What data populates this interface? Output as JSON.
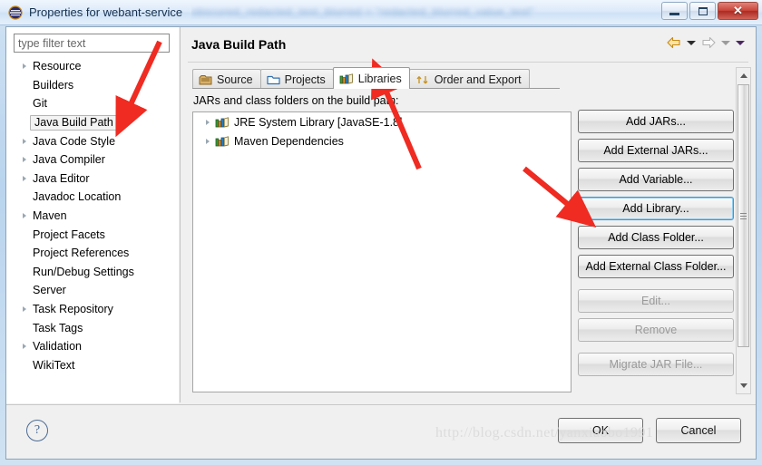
{
  "window": {
    "title": "Properties for webant-service",
    "title_blurred_suffix": "obscured_redacted_text_blurred = \"redacted_blurred_value_text\"",
    "icon": "eclipse-icon",
    "controls": {
      "minimize": "minimize-icon",
      "maximize": "maximize-icon",
      "close": "✕"
    }
  },
  "sidebar": {
    "filter": {
      "placeholder": "type filter text",
      "value": ""
    },
    "items": [
      {
        "label": "Resource",
        "expandable": true,
        "selected": false
      },
      {
        "label": "Builders",
        "expandable": false,
        "selected": false
      },
      {
        "label": "Git",
        "expandable": false,
        "selected": false
      },
      {
        "label": "Java Build Path",
        "expandable": false,
        "selected": true
      },
      {
        "label": "Java Code Style",
        "expandable": true,
        "selected": false
      },
      {
        "label": "Java Compiler",
        "expandable": true,
        "selected": false
      },
      {
        "label": "Java Editor",
        "expandable": true,
        "selected": false
      },
      {
        "label": "Javadoc Location",
        "expandable": false,
        "selected": false
      },
      {
        "label": "Maven",
        "expandable": true,
        "selected": false
      },
      {
        "label": "Project Facets",
        "expandable": false,
        "selected": false
      },
      {
        "label": "Project References",
        "expandable": false,
        "selected": false
      },
      {
        "label": "Run/Debug Settings",
        "expandable": false,
        "selected": false
      },
      {
        "label": "Server",
        "expandable": false,
        "selected": false
      },
      {
        "label": "Task Repository",
        "expandable": true,
        "selected": false
      },
      {
        "label": "Task Tags",
        "expandable": false,
        "selected": false
      },
      {
        "label": "Validation",
        "expandable": true,
        "selected": false
      },
      {
        "label": "WikiText",
        "expandable": false,
        "selected": false
      }
    ]
  },
  "main": {
    "page_title": "Java Build Path",
    "nav": {
      "back": "back-arrow-icon",
      "back_menu": "chevron-down-icon",
      "forward": "forward-arrow-icon",
      "forward_menu": "chevron-down-icon",
      "view_menu": "chevron-down-icon"
    },
    "tabs": [
      {
        "label": "Source",
        "icon": "source-folder-icon",
        "active": false
      },
      {
        "label": "Projects",
        "icon": "projects-folder-icon",
        "active": false
      },
      {
        "label": "Libraries",
        "icon": "libraries-books-icon",
        "active": true
      },
      {
        "label": "Order and Export",
        "icon": "order-export-arrows-icon",
        "active": false
      }
    ],
    "list_label": "JARs and class folders on the build path:",
    "list_items": [
      {
        "label": "JRE System Library [JavaSE-1.8]",
        "icon": "library-books-icon",
        "expandable": true
      },
      {
        "label": "Maven Dependencies",
        "icon": "library-books-icon",
        "expandable": true
      }
    ],
    "buttons": [
      {
        "label": "Add JARs...",
        "disabled": false,
        "focused": false,
        "gap": false
      },
      {
        "label": "Add External JARs...",
        "disabled": false,
        "focused": false,
        "gap": false
      },
      {
        "label": "Add Variable...",
        "disabled": false,
        "focused": false,
        "gap": false
      },
      {
        "label": "Add Library...",
        "disabled": false,
        "focused": true,
        "gap": false
      },
      {
        "label": "Add Class Folder...",
        "disabled": false,
        "focused": false,
        "gap": false
      },
      {
        "label": "Add External Class Folder...",
        "disabled": false,
        "focused": false,
        "gap": false
      },
      {
        "label": "Edit...",
        "disabled": true,
        "focused": false,
        "gap": true
      },
      {
        "label": "Remove",
        "disabled": true,
        "focused": false,
        "gap": false
      },
      {
        "label": "Migrate JAR File...",
        "disabled": true,
        "focused": false,
        "gap": true
      }
    ],
    "scrollbar": {
      "up": "scroll-up-arrow-icon",
      "down": "scroll-down-arrow-icon"
    }
  },
  "footer": {
    "help": "?",
    "ok_label": "OK",
    "cancel_label": "Cancel"
  },
  "watermark": "http://blog.csdn.net/yanxiaobo1991",
  "annotations": {
    "arrow_count": 3,
    "color": "#ef2b22",
    "targets": [
      "Java Build Path",
      "Libraries",
      "Add Library..."
    ]
  }
}
